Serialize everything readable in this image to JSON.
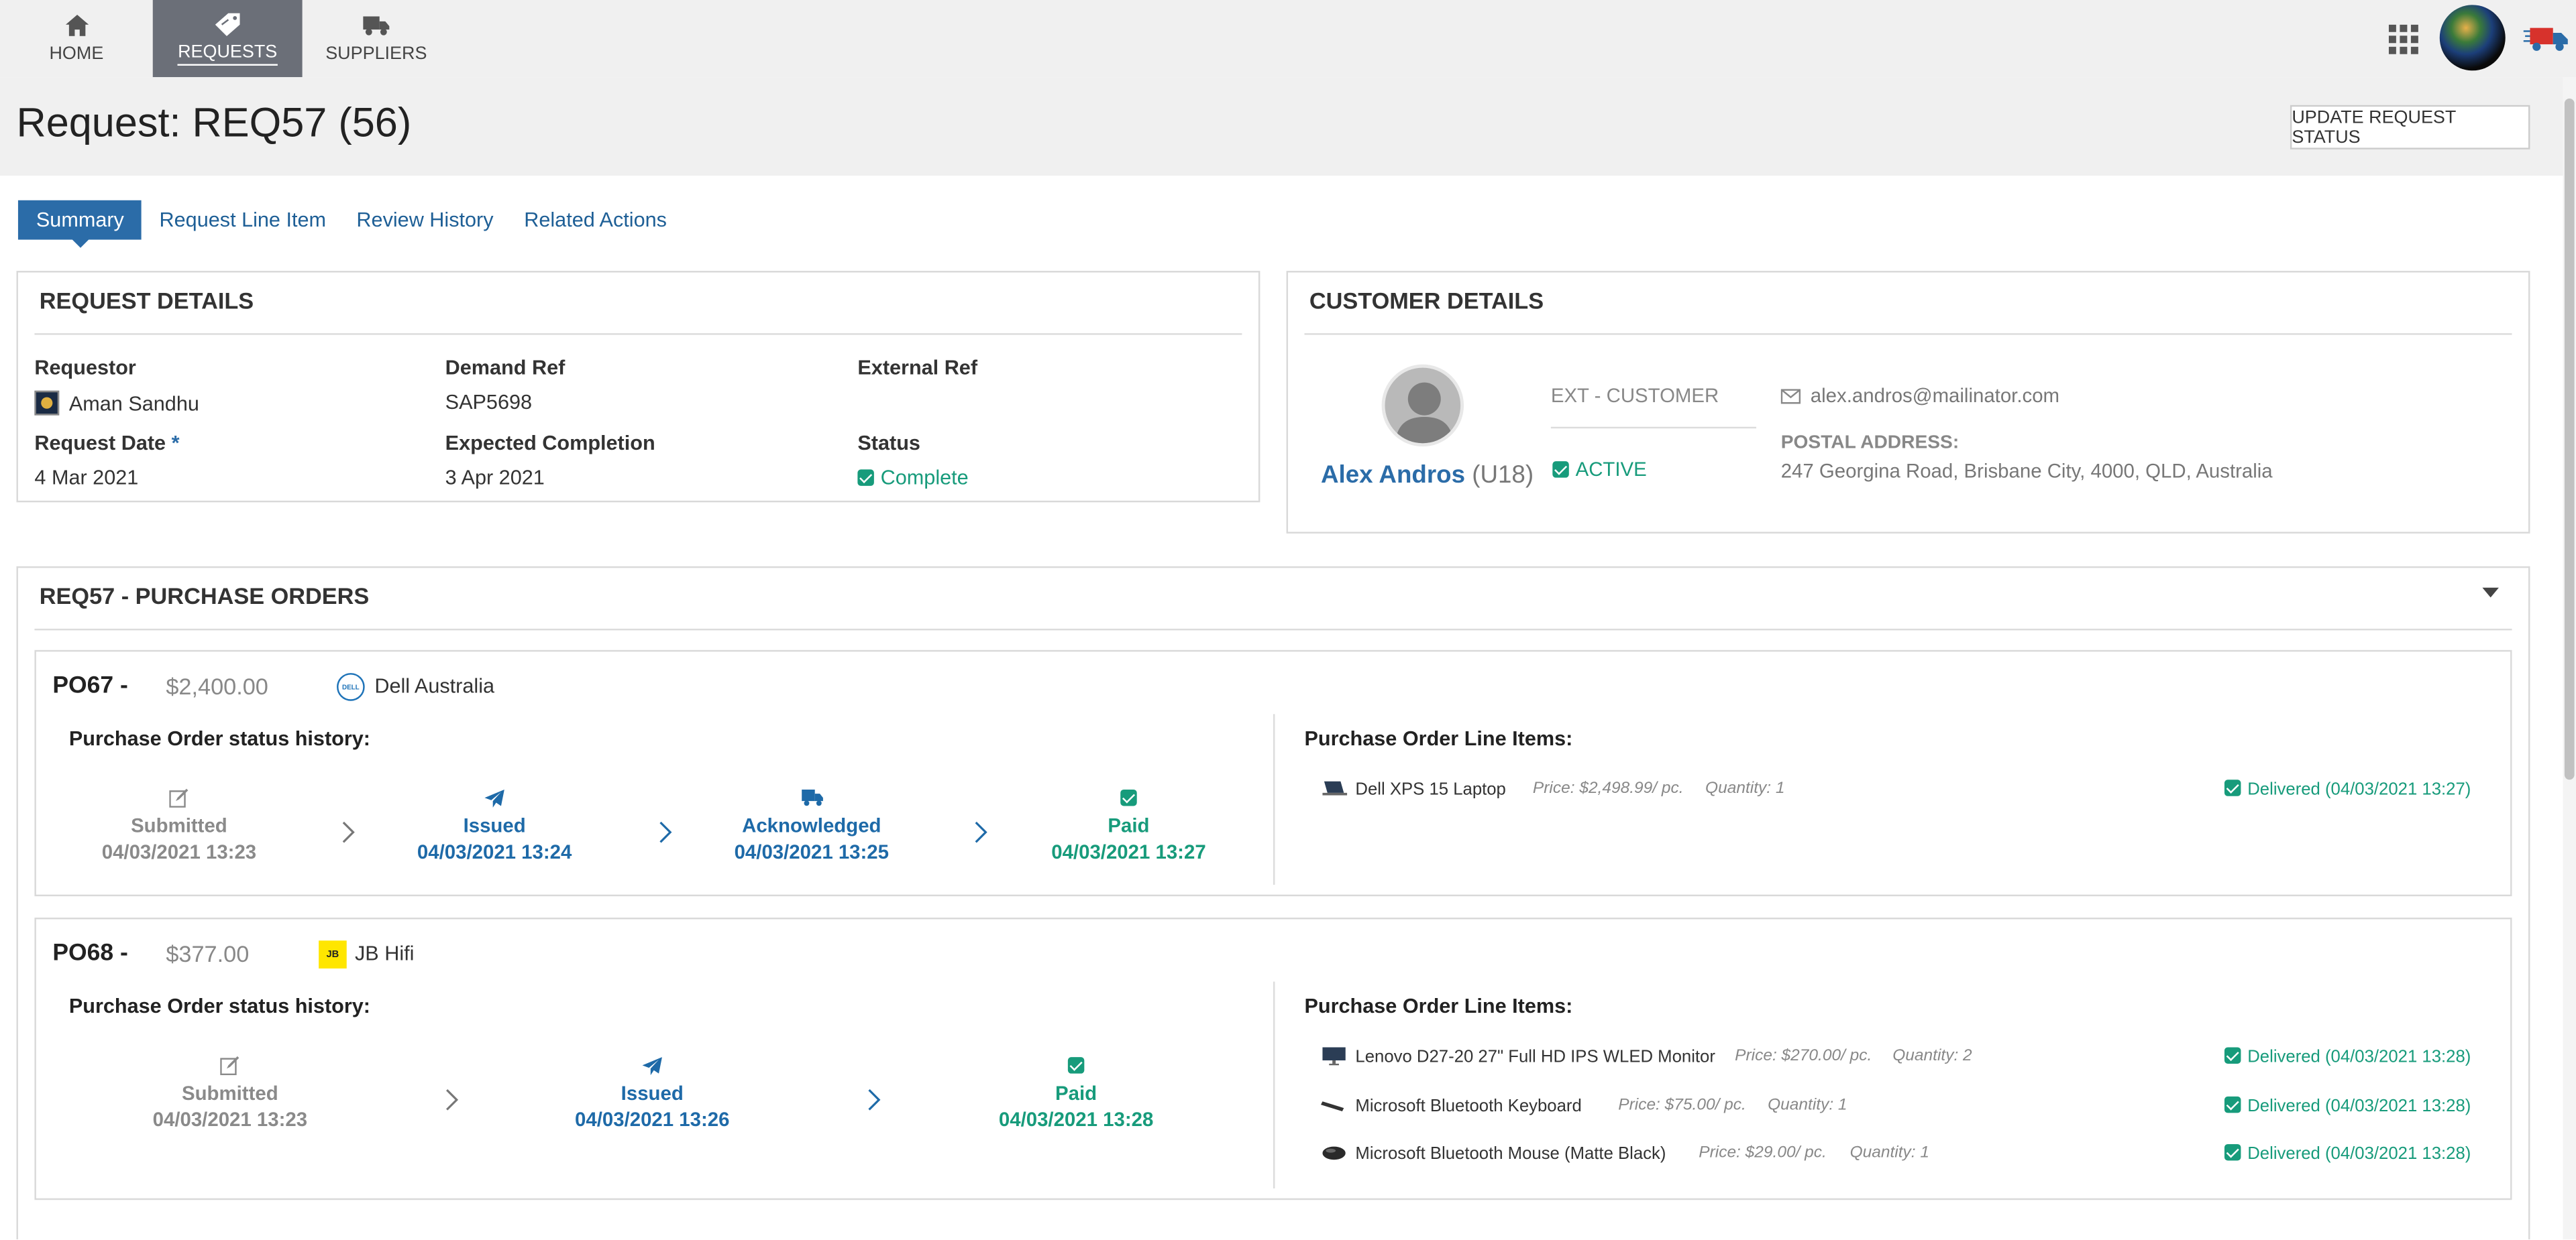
{
  "nav": {
    "items": [
      {
        "label": "HOME",
        "icon": "home-icon"
      },
      {
        "label": "REQUESTS",
        "icon": "tag-icon",
        "active": true
      },
      {
        "label": "SUPPLIERS",
        "icon": "truck-icon"
      }
    ]
  },
  "header": {
    "title": "Request: REQ57 (56)",
    "update_button": "UPDATE REQUEST STATUS"
  },
  "tabs": [
    {
      "label": "Summary",
      "active": true
    },
    {
      "label": "Request Line Item"
    },
    {
      "label": "Review History"
    },
    {
      "label": "Related Actions"
    }
  ],
  "request_details": {
    "title": "REQUEST DETAILS",
    "requestor_label": "Requestor",
    "requestor_value": "Aman Sandhu",
    "demand_ref_label": "Demand Ref",
    "demand_ref_value": "SAP5698",
    "external_ref_label": "External Ref",
    "external_ref_value": "",
    "request_date_label": "Request Date",
    "request_date_required": "*",
    "request_date_value": "4 Mar 2021",
    "expected_completion_label": "Expected Completion",
    "expected_completion_value": "3 Apr 2021",
    "status_label": "Status",
    "status_value": "Complete"
  },
  "customer_details": {
    "title": "CUSTOMER DETAILS",
    "name": "Alex Andros",
    "uid": "(U18)",
    "type": "EXT - CUSTOMER",
    "active": "ACTIVE",
    "email": "alex.andros@mailinator.com",
    "postal_label": "POSTAL ADDRESS:",
    "postal_value": "247 Georgina Road, Brisbane City, 4000, QLD, Australia"
  },
  "purchase_orders": {
    "title": "REQ57 - PURCHASE ORDERS",
    "status_history_label": "Purchase Order status history:",
    "line_items_label": "Purchase Order Line Items:",
    "orders": [
      {
        "number": "PO67 -",
        "amount": "$2,400.00",
        "supplier": "Dell Australia",
        "supplier_logo": "DELL",
        "steps": [
          {
            "name": "Submitted",
            "date": "04/03/2021 13:23"
          },
          {
            "name": "Issued",
            "date": "04/03/2021 13:24"
          },
          {
            "name": "Acknowledged",
            "date": "04/03/2021 13:25"
          },
          {
            "name": "Paid",
            "date": "04/03/2021 13:27"
          }
        ],
        "items": [
          {
            "name": "Dell XPS 15 Laptop",
            "price": "Price: $2,498.99/ pc.",
            "qty": "Quantity: 1",
            "status": "Delivered (04/03/2021 13:27)"
          }
        ]
      },
      {
        "number": "PO68 -",
        "amount": "$377.00",
        "supplier": "JB Hifi",
        "supplier_logo": "JB",
        "steps": [
          {
            "name": "Submitted",
            "date": "04/03/2021 13:23"
          },
          {
            "name": "Issued",
            "date": "04/03/2021 13:26"
          },
          {
            "name": "Paid",
            "date": "04/03/2021 13:28"
          }
        ],
        "items": [
          {
            "name": "Lenovo D27-20 27\" Full HD IPS WLED Monitor",
            "price": "Price: $270.00/ pc.",
            "qty": "Quantity: 2",
            "status": "Delivered (04/03/2021 13:28)"
          },
          {
            "name": "Microsoft Bluetooth Keyboard",
            "price": "Price: $75.00/ pc.",
            "qty": "Quantity: 1",
            "status": "Delivered (04/03/2021 13:28)"
          },
          {
            "name": "Microsoft Bluetooth Mouse (Matte Black)",
            "price": "Price: $29.00/ pc.",
            "qty": "Quantity: 1",
            "status": "Delivered (04/03/2021 13:28)"
          }
        ]
      }
    ]
  },
  "colors": {
    "accent_blue": "#2b6ca8",
    "success_teal": "#179b7b",
    "nav_active": "#6b6f78"
  }
}
